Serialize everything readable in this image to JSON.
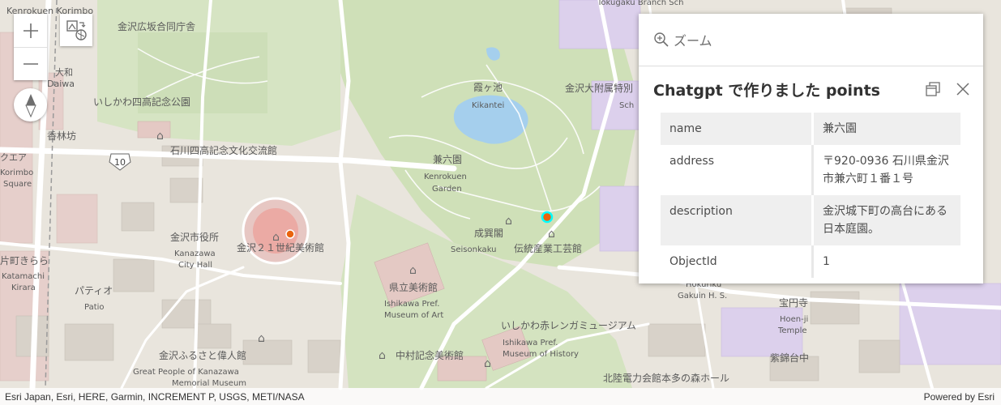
{
  "map": {
    "labels": {
      "hotel_top": "Kenrokuen Korimbo",
      "govt_office": "金沢広坂合同庁舎",
      "daiwa_jp": "大和",
      "daiwa_en": "Daiwa",
      "memorial_park": "いしかわ四高記念公園",
      "korinbo_jp": "香林坊",
      "square_jp": "クエア",
      "korimbo_en": "Korimbo",
      "square_en": "Square",
      "route_number": "10",
      "exchange_hall": "石川四高記念文化交流館",
      "city_hall_jp": "金沢市役所",
      "city_hall_en1": "Kanazawa",
      "city_hall_en2": "City Hall",
      "museum21": "金沢２１世紀美術館",
      "katamachi_jp": "片町きらら",
      "katamachi_en1": "Katamachi",
      "katamachi_en2": "Kirara",
      "patio_jp": "パティオ",
      "patio_en": "Patio",
      "kenrokuen_jp": "兼六園",
      "kenrokuen_en1": "Kenrokuen",
      "kenrokuen_en2": "Garden",
      "kikantei_jp": "霞ヶ池",
      "kikantei_en": "Kikantei",
      "seisonkaku_jp": "成巽閣",
      "seisonkaku_en": "Seisonkaku",
      "craft_museum": "伝統産業工芸館",
      "pref_museum_jp": "県立美術館",
      "pref_museum_en1": "Ishikawa Pref.",
      "pref_museum_en2": "Museum of Art",
      "redbrick_museum": "いしかわ赤レンガミュージアム",
      "history_museum_en1": "Ishikawa Pref.",
      "history_museum_en2": "Museum of History",
      "nakamura_museum": "中村記念美術館",
      "furusato_jp": "金沢ふるさと偉人館",
      "furusato_en1": "Great People of Kanazawa",
      "furusato_en2": "Memorial Museum",
      "hokuriku_hall": "北陸電力会館本多の森ホール",
      "univ_school": "金沢大附属特別",
      "univ_school_en": "Sch",
      "top_school": "Tokugaku Branch Sch",
      "gakuin_en1": "Hokuriku",
      "gakuin_en2": "Gakuin H. S.",
      "hoenji_jp": "宝円寺",
      "hoenji_en1": "Hoen-ji",
      "hoenji_en2": "Temple",
      "hill_jp": "紫錦台中"
    }
  },
  "controls": {
    "zoom_in": "+",
    "zoom_out": "—"
  },
  "popup": {
    "zoom_label": "ズーム",
    "title": "Chatgpt で作りました points",
    "rows": [
      {
        "key": "name",
        "value": "兼六園"
      },
      {
        "key": "address",
        "value": "〒920-0936 石川県金沢市兼六町１番１号"
      },
      {
        "key": "description",
        "value": "金沢城下町の高台にある日本庭園。"
      },
      {
        "key": "ObjectId",
        "value": "1"
      }
    ]
  },
  "attribution": {
    "sources": "Esri Japan, Esri, HERE, Garmin, INCREMENT P, USGS, METI/NASA",
    "powered_by": "Powered by Esri"
  },
  "colors": {
    "park_green": "#d3e3bf",
    "water_blue": "#a8d0ee",
    "urban_pink": "#e8d4d0",
    "road_white": "#ffffff",
    "selection_cyan": "#00ffff",
    "marker_orange": "#e9640f"
  }
}
